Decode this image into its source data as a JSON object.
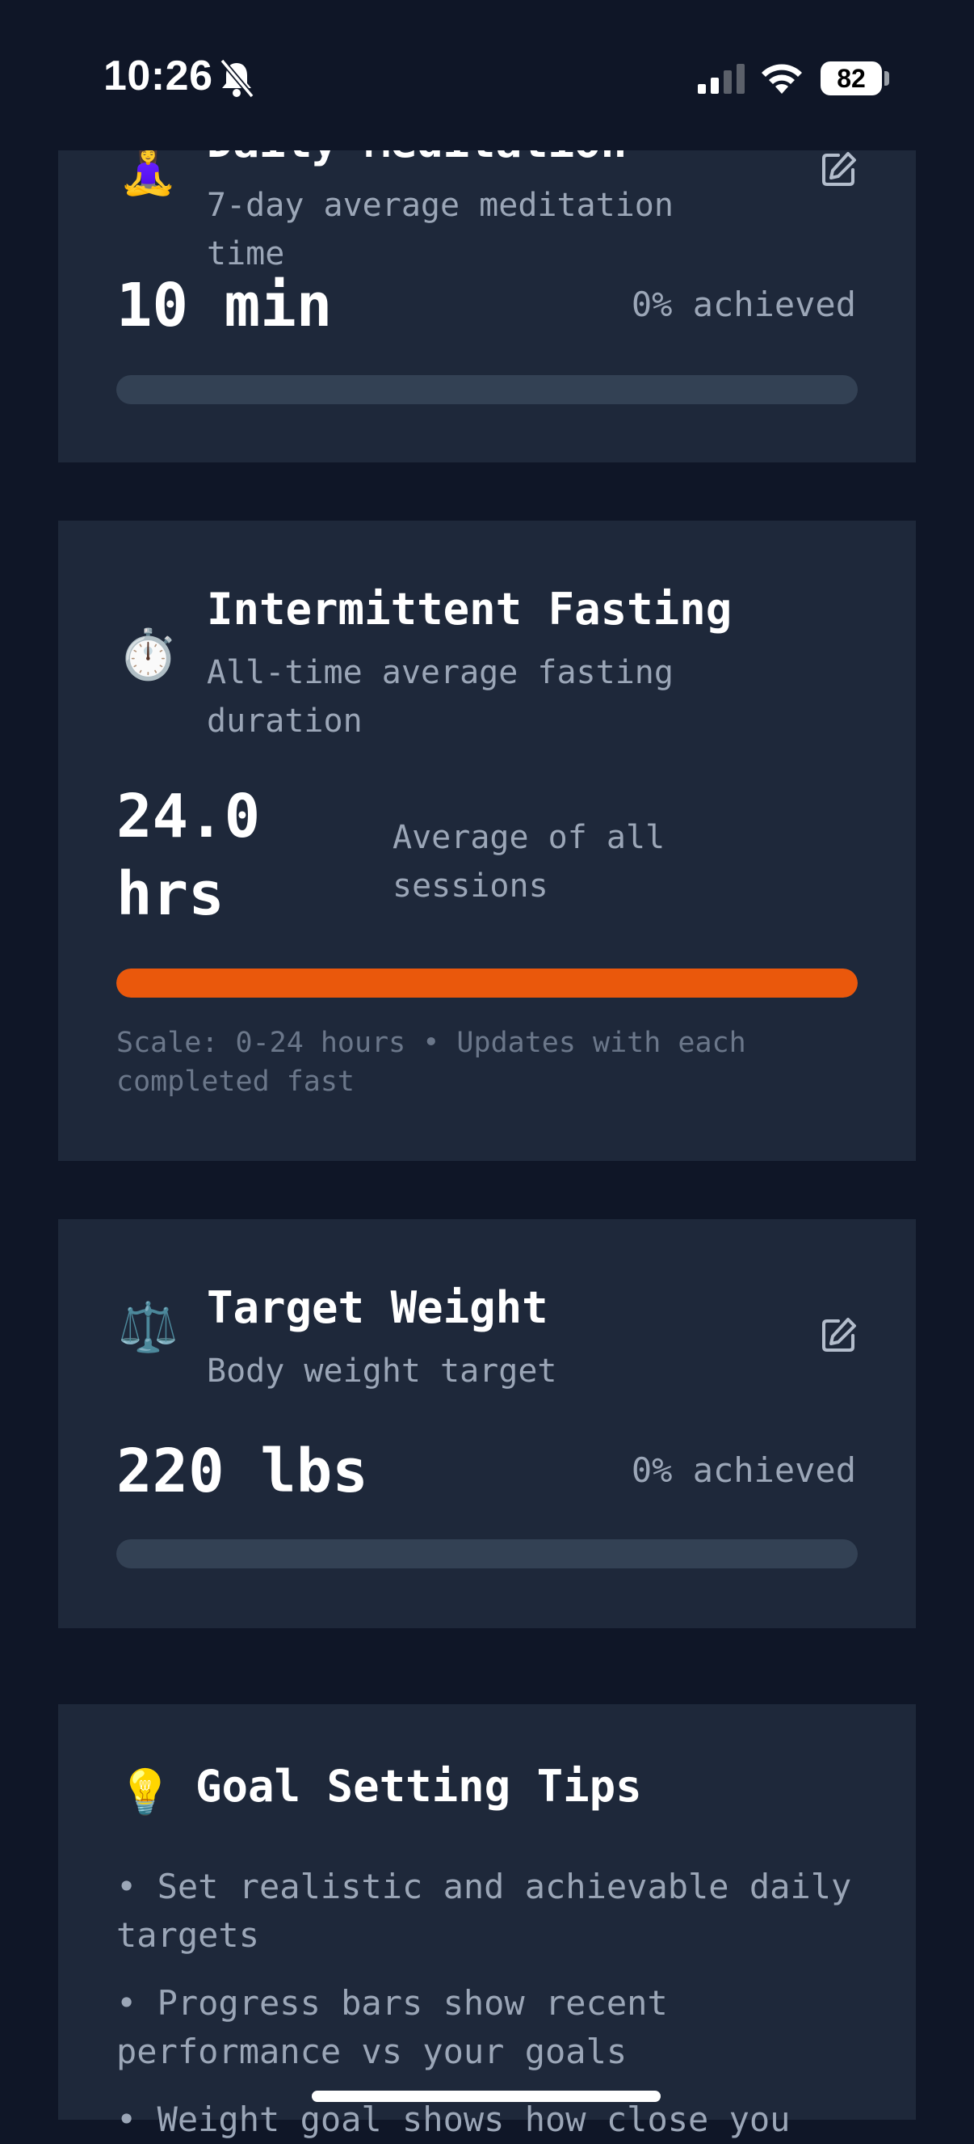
{
  "status_bar": {
    "time": "10:26",
    "battery": "82",
    "icons": [
      "bell-slash-icon",
      "cellular-signal-icon",
      "wifi-icon",
      "battery-icon"
    ]
  },
  "goals": [
    {
      "emoji": "🧘‍♀️",
      "title": "Daily Meditation",
      "subtitle": "7-day average meditation time",
      "value": "10 min",
      "status": "0% achieved",
      "progress_fraction": 0.0,
      "editable": true
    },
    {
      "emoji": "⏱️",
      "title": "Intermittent Fasting",
      "subtitle": "All-time average fasting duration",
      "value": "24.0 hrs",
      "status": "Average of all sessions",
      "progress_fraction": 1.0,
      "note": "Scale: 0-24 hours • Updates with each completed fast",
      "editable": false
    },
    {
      "emoji": "⚖️",
      "title": "Target Weight",
      "subtitle": "Body weight target",
      "value": "220 lbs",
      "status": "0% achieved",
      "progress_fraction": 0.0,
      "editable": true
    }
  ],
  "tips": {
    "emoji": "💡",
    "title": "Goal Setting Tips",
    "items": [
      "• Set realistic and achievable daily targets",
      "• Progress bars show recent performance vs your goals",
      "• Weight goal shows how close you"
    ]
  },
  "colors": {
    "background": "#0f1627",
    "card": "#1e283a",
    "accent": "#ea580c",
    "track": "#334154",
    "muted_text": "#9ba6b7"
  }
}
